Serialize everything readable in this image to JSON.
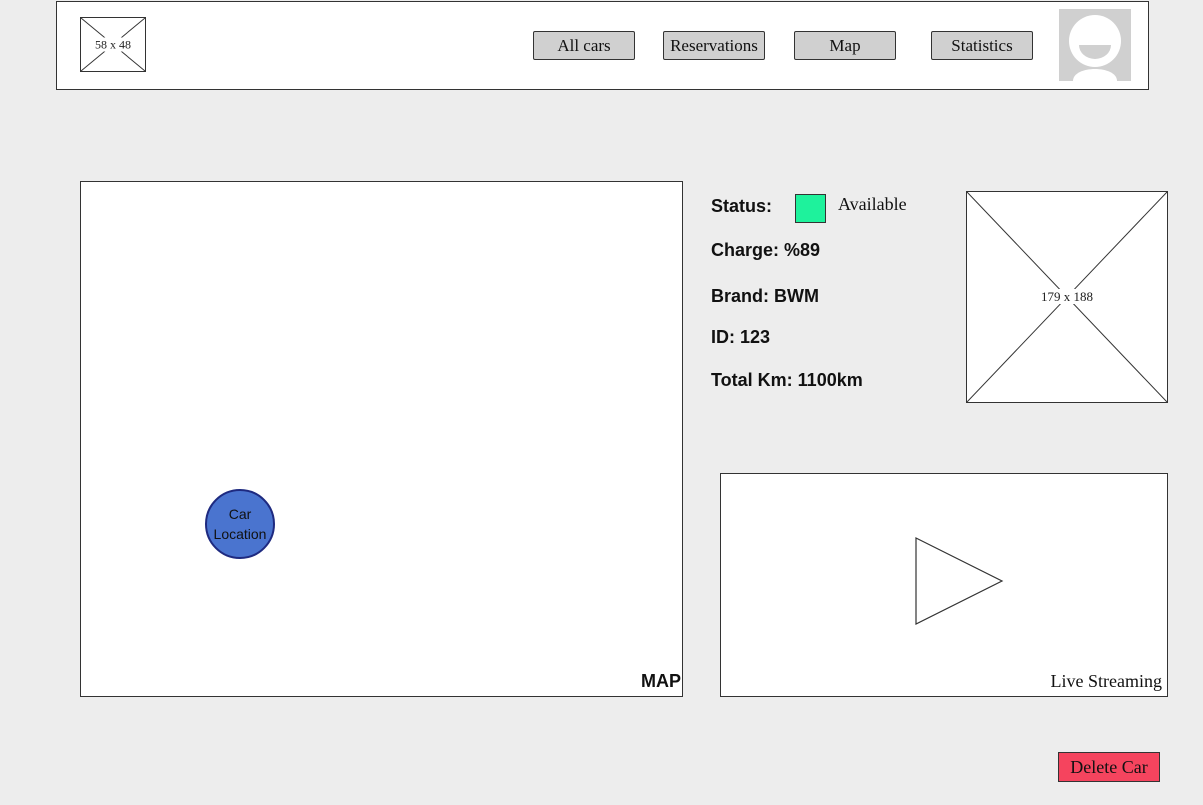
{
  "header": {
    "logo_placeholder": "58 x 48",
    "nav": [
      "All cars",
      "Reservations",
      "Map",
      "Statistics"
    ]
  },
  "map": {
    "label": "MAP",
    "car_location_line1": "Car",
    "car_location_line2": "Location"
  },
  "details": {
    "status_label": "Status:",
    "status_value": "Available",
    "status_color": "#1ef29c",
    "charge": "Charge: %89",
    "brand": "Brand: BWM",
    "id": "ID: 123",
    "total_km": "Total Km: 1100km"
  },
  "car_image": {
    "placeholder": "179 x 188"
  },
  "video": {
    "label": "Live Streaming"
  },
  "actions": {
    "delete_label": "Delete Car",
    "delete_color": "#f5445e"
  }
}
